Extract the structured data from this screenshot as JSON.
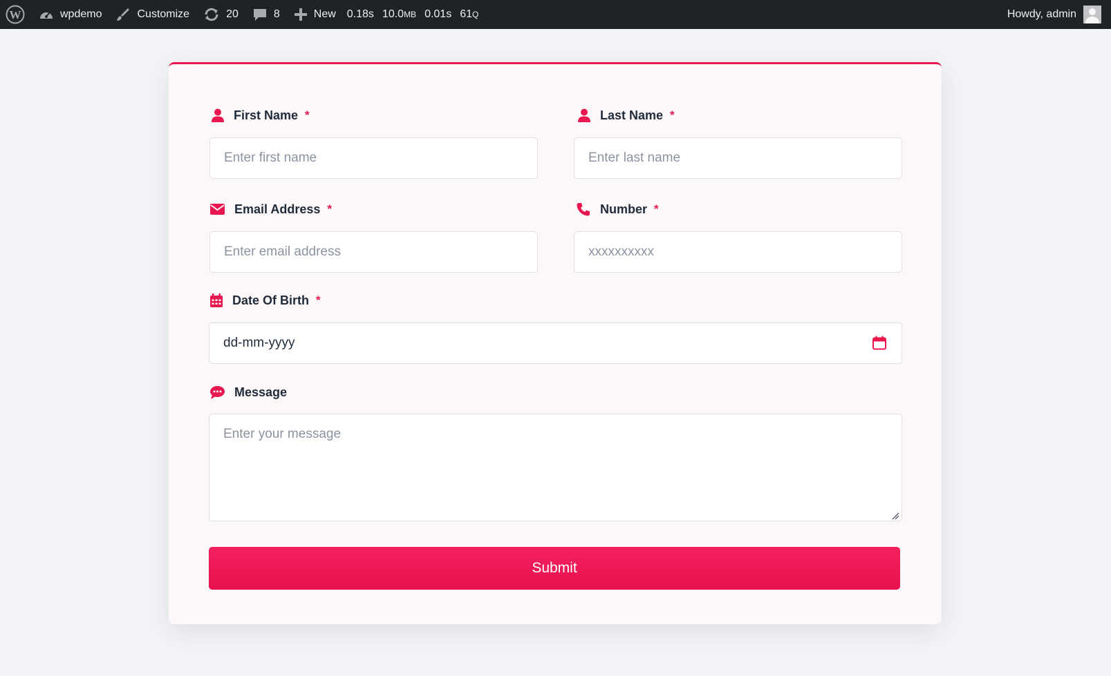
{
  "adminbar": {
    "site_name": "wpdemo",
    "customize_label": "Customize",
    "updates_count": "20",
    "comments_count": "8",
    "new_label": "New",
    "stats": {
      "time": "0.18s",
      "memory_value": "10.0",
      "memory_unit": "MB",
      "query_time": "0.01s",
      "queries_value": "61",
      "queries_unit": "Q"
    },
    "greeting": "Howdy, admin"
  },
  "form": {
    "first_name": {
      "label": "First Name",
      "required_mark": "*",
      "placeholder": "Enter first name",
      "icon": "user-icon"
    },
    "last_name": {
      "label": "Last Name",
      "required_mark": "*",
      "placeholder": "Enter last name",
      "icon": "user-icon"
    },
    "email": {
      "label": "Email Address",
      "required_mark": "*",
      "placeholder": "Enter email address",
      "icon": "envelope-icon"
    },
    "number": {
      "label": "Number",
      "required_mark": "*",
      "placeholder": "xxxxxxxxxx",
      "icon": "phone-icon"
    },
    "dob": {
      "label": "Date Of Birth",
      "required_mark": "*",
      "value": "dd-mm-yyyy",
      "icon": "calendar-icon"
    },
    "message": {
      "label": "Message",
      "placeholder": "Enter your message",
      "icon": "chat-bubble-icon"
    },
    "submit_label": "Submit"
  },
  "colors": {
    "accent": "#e8174f",
    "adminbar_bg": "#1d2327",
    "label_text": "#1f2a3a",
    "card_bg": "#fcf7f8",
    "page_bg": "#f3f4f7"
  }
}
